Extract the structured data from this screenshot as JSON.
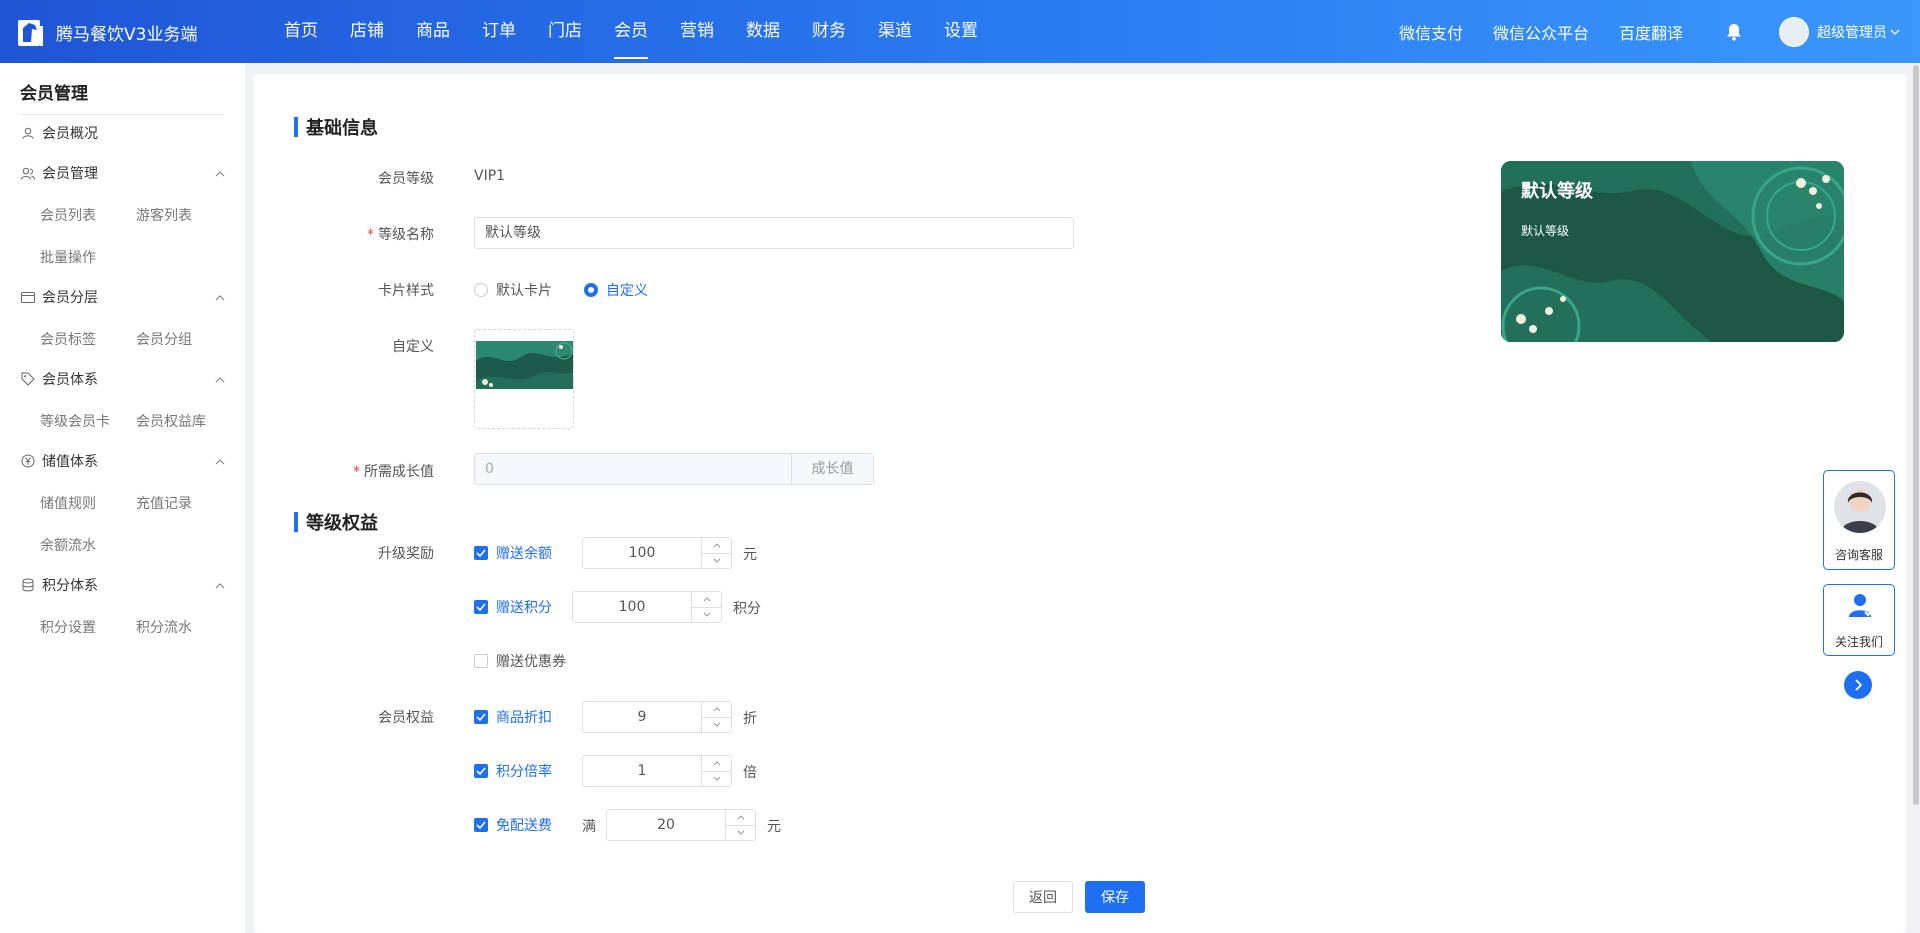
{
  "app": {
    "title": "腾马餐饮V3业务端"
  },
  "nav": [
    "首页",
    "店铺",
    "商品",
    "订单",
    "门店",
    "会员",
    "营销",
    "数据",
    "财务",
    "渠道",
    "设置"
  ],
  "top_right": {
    "wechat_pay": "微信支付",
    "wechat_mp": "微信公众平台",
    "baidu": "百度翻译",
    "user": "超级管理员"
  },
  "sidebar": {
    "title": "会员管理",
    "overview": "会员概况",
    "groups": [
      {
        "label": "会员管理",
        "items": [
          "会员列表",
          "游客列表",
          "批量操作"
        ]
      },
      {
        "label": "会员分层",
        "items": [
          "会员标签",
          "会员分组"
        ]
      },
      {
        "label": "会员体系",
        "items": [
          "等级会员卡",
          "会员权益库"
        ]
      },
      {
        "label": "储值体系",
        "items": [
          "储值规则",
          "充值记录",
          "余额流水"
        ]
      },
      {
        "label": "积分体系",
        "items": [
          "积分设置",
          "积分流水"
        ]
      }
    ]
  },
  "basic": {
    "section_title": "基础信息",
    "level_label": "会员等级",
    "level_value": "VIP1",
    "name_label": "等级名称",
    "name_value": "默认等级",
    "card_style_label": "卡片样式",
    "card_style_options": [
      "默认卡片",
      "自定义"
    ],
    "card_style_selected": "自定义",
    "custom_label": "自定义",
    "growth_label": "所需成长值",
    "growth_value": "0",
    "growth_suffix": "成长值"
  },
  "rights": {
    "section_title": "等级权益",
    "upgrade_label": "升级奖励",
    "member_rights_label": "会员权益",
    "upgrade_items": [
      {
        "label": "赠送余额",
        "checked": true,
        "value": "100",
        "unit": "元"
      },
      {
        "label": "赠送积分",
        "checked": true,
        "value": "100",
        "unit": "积分"
      },
      {
        "label": "赠送优惠券",
        "checked": false
      }
    ],
    "member_items": [
      {
        "label": "商品折扣",
        "checked": true,
        "value": "9",
        "unit": "折"
      },
      {
        "label": "积分倍率",
        "checked": true,
        "value": "1",
        "unit": "倍"
      },
      {
        "label": "免配送费",
        "checked": true,
        "prefix": "满",
        "value": "20",
        "unit": "元"
      }
    ]
  },
  "buttons": {
    "back": "返回",
    "save": "保存"
  },
  "preview": {
    "title": "默认等级",
    "subtitle": "默认等级"
  },
  "float": {
    "consult": "咨询客服",
    "follow": "关注我们"
  },
  "colors": {
    "primary": "#1e6ff1",
    "card_green": "#1d5847"
  }
}
